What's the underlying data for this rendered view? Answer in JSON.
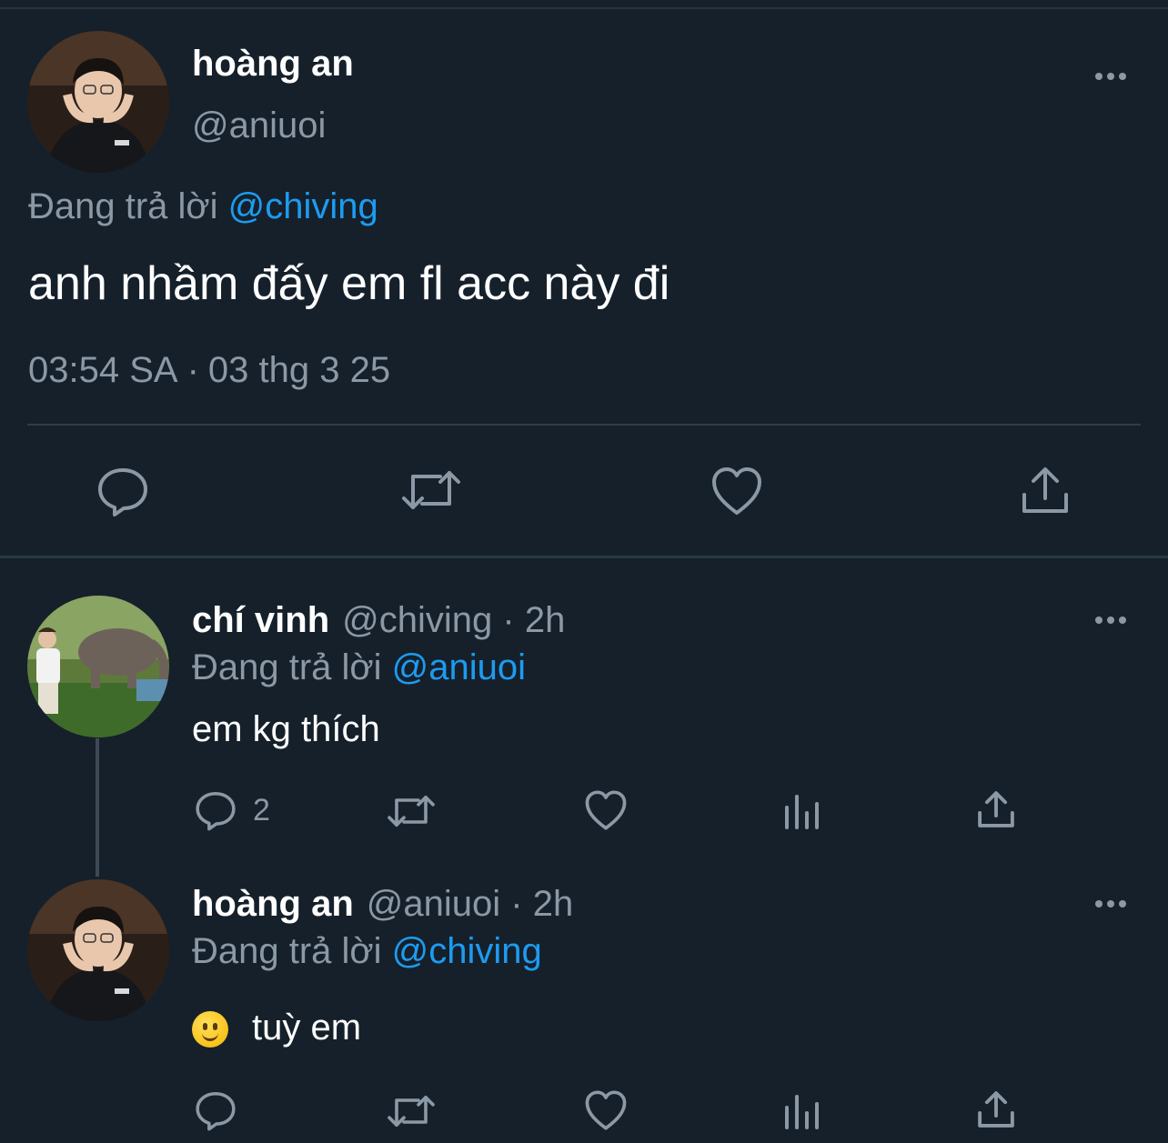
{
  "main_tweet": {
    "author_name": "hoàng an",
    "author_handle": "@aniuoi",
    "reply_prefix": "Đang trả lời",
    "reply_to": "@chiving",
    "text": "anh nhầm đấy em fl acc này đi",
    "time": "03:54 SA",
    "separator": "·",
    "date": "03 thg 3 25",
    "actions": [
      "reply-icon",
      "retweet-icon",
      "like-icon",
      "share-icon"
    ]
  },
  "replies": [
    {
      "author_name": "chí vinh",
      "author_handle": "@chiving",
      "time_ago": "· 2h",
      "reply_prefix": "Đang trả lời",
      "reply_to": "@aniuoi",
      "text": "em kg thích",
      "reply_count": "2",
      "actions": [
        "reply-icon",
        "retweet-icon",
        "like-icon",
        "views-icon",
        "share-icon"
      ]
    },
    {
      "author_name": "hoàng an",
      "author_handle": "@aniuoi",
      "time_ago": "· 2h",
      "reply_prefix": "Đang trả lời",
      "reply_to": "@chiving",
      "emoji": "slightly-smiling-face",
      "text": "tuỳ em",
      "actions": [
        "reply-icon",
        "retweet-icon",
        "like-icon",
        "views-icon",
        "share-icon"
      ]
    }
  ],
  "colors": {
    "background": "#15202b",
    "text_primary": "#ffffff",
    "text_secondary": "#8b98a5",
    "accent": "#1d9bf0",
    "divider": "#2f3d4a"
  }
}
